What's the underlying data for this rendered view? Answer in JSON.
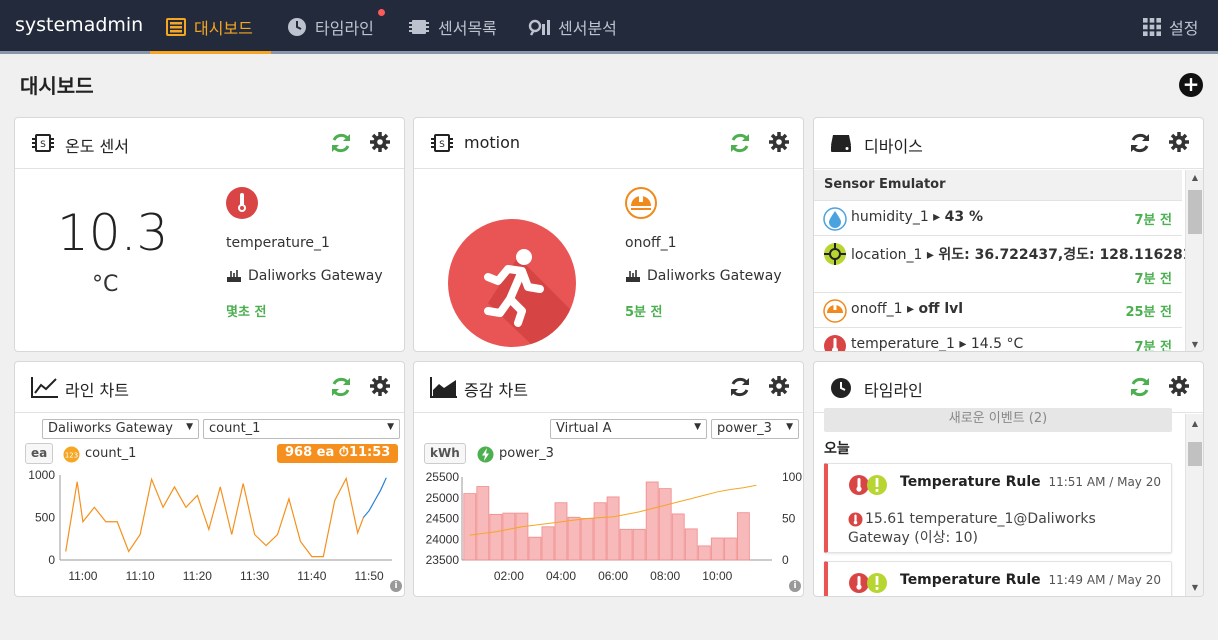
{
  "nav": {
    "brand": "systemadmin",
    "items": [
      {
        "label": "대시보드",
        "icon": "dashboard-icon"
      },
      {
        "label": "타임라인",
        "icon": "clock-icon"
      },
      {
        "label": "센서목록",
        "icon": "chip-icon"
      },
      {
        "label": "센서분석",
        "icon": "analysis-icon"
      }
    ],
    "settings_label": "설정",
    "active_color": "#f5a623"
  },
  "page": {
    "title": "대시보드",
    "add_label": "+"
  },
  "temp_card": {
    "title": "온도 센서",
    "value": "10.3",
    "unit": "°C",
    "sensor": "temperature_1",
    "gateway": "Daliworks Gateway",
    "updated": "몇초 전"
  },
  "motion_card": {
    "title": "motion",
    "sensor": "onoff_1",
    "gateway": "Daliworks Gateway",
    "updated": "5분 전"
  },
  "device_card": {
    "title": "디바이스",
    "group": "Sensor Emulator",
    "rows": [
      {
        "name": "humidity_1",
        "value": "43 %",
        "ago": "7분 전",
        "icon": "humidity-icon"
      },
      {
        "name": "location_1",
        "value": "위도: 36.722437,경도: 128.116281 °",
        "ago": "7분 전",
        "icon": "location-icon"
      },
      {
        "name": "onoff_1",
        "value": "off lvl",
        "ago": "25분 전",
        "icon": "onoff-icon"
      },
      {
        "name": "temperature_1",
        "value": "14.5 °C",
        "ago": "7분 전",
        "icon": "thermometer-icon"
      }
    ]
  },
  "line_card": {
    "title": "라인 차트",
    "gateway_select": "Daliworks Gateway",
    "series_select": "count_1",
    "unit": "ea",
    "legend": "count_1",
    "latest": "968 ea",
    "latest_time": "11:53"
  },
  "area_card": {
    "title": "증감 차트",
    "gateway_select": "Virtual A",
    "series_select": "power_3",
    "unit": "kWh",
    "legend": "power_3"
  },
  "timeline_card": {
    "title": "타임라인",
    "new_events": "새로운 이벤트 (2)",
    "today": "오늘",
    "events": [
      {
        "title": "Temperature Rule",
        "time": "11:51 AM / May 20",
        "message": "15.61 temperature_1@Daliworks Gateway (이상: 10)"
      },
      {
        "title": "Temperature Rule",
        "time": "11:49 AM / May 20"
      }
    ]
  },
  "chart_data": [
    {
      "type": "line",
      "ylim": [
        0,
        1000
      ],
      "yticks": [
        "0",
        "500",
        "1000"
      ],
      "xticks": [
        "11:00",
        "11:10",
        "11:20",
        "11:30",
        "11:40",
        "11:50"
      ],
      "x_minutes": [
        -3,
        -1,
        0,
        2,
        4,
        6,
        8,
        10,
        12,
        14,
        16,
        18,
        20,
        22,
        24,
        26,
        28,
        30,
        32,
        34,
        36,
        38,
        40,
        42,
        44,
        46,
        48,
        49,
        50,
        51,
        52,
        53
      ],
      "series": [
        {
          "name": "count_1",
          "color": "#f5901e",
          "values": [
            100,
            920,
            450,
            620,
            450,
            450,
            100,
            300,
            950,
            620,
            860,
            620,
            760,
            360,
            860,
            300,
            900,
            300,
            170,
            300,
            720,
            220,
            40,
            40,
            700,
            960,
            320,
            500
          ]
        },
        {
          "name": "count_1-latest",
          "color": "#2a7fd4",
          "from_index": 27,
          "values": [
            500,
            580,
            700,
            820,
            968
          ]
        }
      ]
    },
    {
      "type": "bar",
      "ylim": [
        23500,
        25500
      ],
      "yticks": [
        "23500",
        "24000",
        "24500",
        "25000",
        "25500"
      ],
      "y2lim": [
        0,
        100
      ],
      "y2ticks": [
        "0",
        "50",
        "100"
      ],
      "xticks": [
        "02:00",
        "04:00",
        "06:00",
        "08:00",
        "10:00"
      ],
      "hours": [
        0.5,
        1,
        1.5,
        2,
        2.5,
        3,
        3.5,
        4,
        4.5,
        5,
        5.5,
        6,
        6.5,
        7,
        7.5,
        8,
        8.5,
        9,
        9.5,
        10,
        10.5,
        11,
        11.5
      ],
      "series": [
        {
          "name": "power_3",
          "color": "#f08a8a",
          "values": [
            25100,
            25270,
            24600,
            24630,
            24630,
            24050,
            24300,
            24880,
            24530,
            24500,
            24880,
            25020,
            24240,
            24240,
            25380,
            25220,
            24610,
            24250,
            23840,
            24030,
            24030,
            24640,
            23000
          ]
        },
        {
          "name": "power_3-cumulative",
          "color": "#f5a623",
          "axis": "right",
          "values": [
            30,
            32,
            34,
            37,
            40,
            42,
            44,
            46,
            48,
            50,
            51,
            52,
            55,
            58,
            62,
            66,
            70,
            74,
            78,
            82,
            85,
            87,
            90
          ]
        }
      ]
    }
  ]
}
